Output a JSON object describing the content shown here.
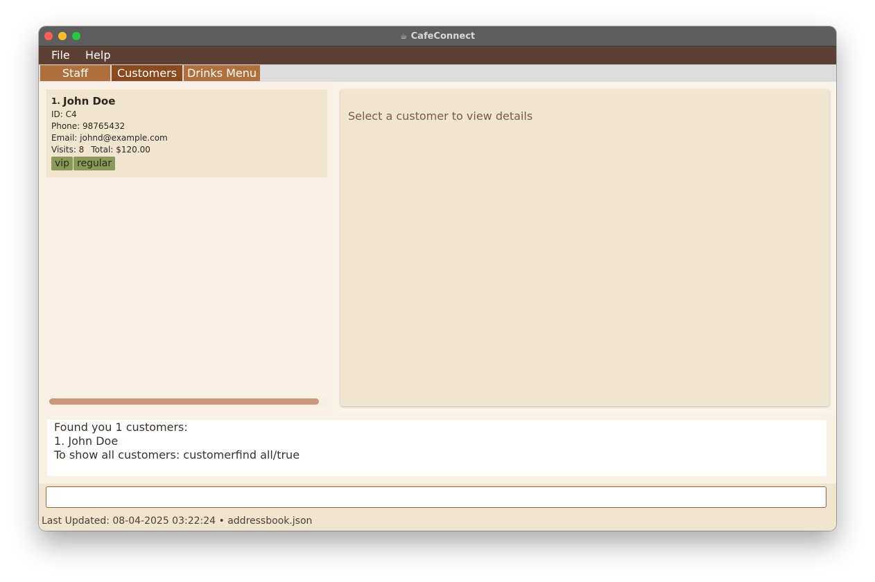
{
  "window": {
    "title": "CafeConnect",
    "app_icon": "coffee-cup-icon"
  },
  "menu": {
    "file": "File",
    "help": "Help"
  },
  "tabs": [
    {
      "label": "Staff"
    },
    {
      "label": "Customers",
      "selected": true
    },
    {
      "label": "Drinks Menu"
    }
  ],
  "customers": [
    {
      "index": "1.",
      "name": "John Doe",
      "id": "ID: C4",
      "phone": "Phone: 98765432",
      "email": "Email: johnd@example.com",
      "visits": "Visits: 8",
      "total": "Total: $120.00",
      "tags": [
        "vip",
        "regular"
      ]
    }
  ],
  "detail": {
    "placeholder": "Select a customer to view details"
  },
  "result": {
    "lines": [
      "Found you 1 customers:",
      "1. John Doe",
      "To show all customers: customerfind all/true"
    ]
  },
  "command": {
    "value": ""
  },
  "status": {
    "text": "Last Updated: 08-04-2025 03:22:24 • addressbook.json"
  },
  "colors": {
    "menubar": "#5c4033",
    "tab_active": "#8a4a1e",
    "tab_inactive": "#b0703d",
    "panel": "#f0e5cf",
    "tag": "#8a9a5b",
    "scroll_thumb": "#c9987a"
  }
}
